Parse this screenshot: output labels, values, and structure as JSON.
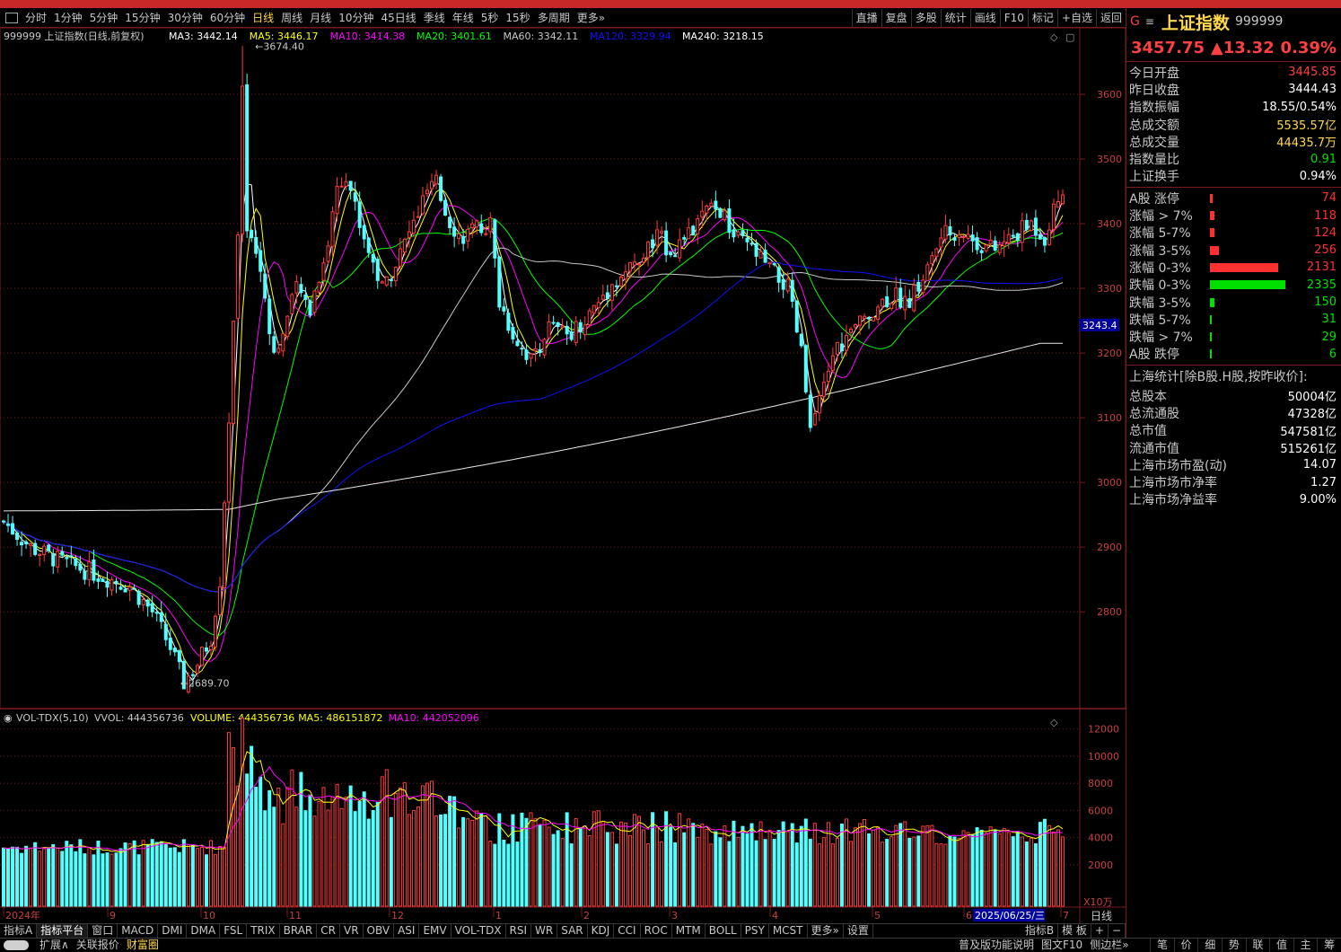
{
  "toolbar": {
    "periods": [
      "分时",
      "1分钟",
      "5分钟",
      "15分钟",
      "30分钟",
      "60分钟",
      "日线",
      "周线",
      "月线",
      "10分钟",
      "45日线",
      "季线",
      "年线",
      "5秒",
      "15秒",
      "多周期",
      "更多»"
    ],
    "selected": "日线",
    "right": [
      "直播",
      "复盘",
      "多股",
      "统计",
      "画线",
      "F10",
      "标记",
      "+自选",
      "返回"
    ]
  },
  "chart": {
    "legend_title": "999999 上证指数(日线,前复权)",
    "ma": [
      {
        "label": "MA3: 3442.14",
        "color": "#ffffff"
      },
      {
        "label": "MA5: 3446.17",
        "color": "#ffff00"
      },
      {
        "label": "MA10: 3414.38",
        "color": "#ff00ff"
      },
      {
        "label": "MA20: 3401.61",
        "color": "#00ff00"
      },
      {
        "label": "MA60: 3342.11",
        "color": "#c8c8c8"
      },
      {
        "label": "MA120: 3329.94",
        "color": "#1010ff"
      },
      {
        "label": "MA240: 3218.15",
        "color": "#ffffff"
      }
    ],
    "high_label": "3674.40",
    "low_label": "2689.70",
    "current_price_tag": "3243.4",
    "price_ticks": [
      "3600",
      "3500",
      "3400",
      "3300",
      "3200",
      "3100",
      "3000",
      "2900",
      "2800"
    ],
    "vol_legend": {
      "title": "VOL-TDX(5,10)",
      "items": [
        {
          "label": "VVOL: 444356736",
          "color": "#c8c8c8"
        },
        {
          "label": "VOLUME: 444356736",
          "color": "#ffff00"
        },
        {
          "label": "MA5: 486151872",
          "color": "#ffff00"
        },
        {
          "label": "MA10: 442052096",
          "color": "#ff00ff"
        }
      ]
    },
    "vol_ticks": [
      "12000",
      "10000",
      "8000",
      "6000",
      "4000",
      "2000"
    ],
    "vol_unit": "X10万",
    "date_labels": [
      "2024年",
      "9",
      "10",
      "11",
      "12",
      "1",
      "2",
      "3",
      "4",
      "5",
      "6",
      "7"
    ],
    "date_cursor": "2025/06/25/三",
    "axis_period": "日线"
  },
  "quote": {
    "g": "G",
    "menu": "≡",
    "name": "上证指数",
    "code": "999999",
    "price": "3457.75",
    "change": "▲13.32",
    "pct": "0.39%",
    "rows": [
      {
        "label": "今日开盘",
        "value": "3445.85",
        "color": "#ff4040"
      },
      {
        "label": "昨日收盘",
        "value": "3444.43",
        "color": "#ffffff"
      },
      {
        "label": "指数振幅",
        "value": "18.55/0.54%",
        "color": "#ffffff"
      },
      {
        "label": "总成交额",
        "value": "5535.57亿",
        "color": "#ffd84a"
      },
      {
        "label": "总成交量",
        "value": "44435.7万",
        "color": "#ffd84a"
      },
      {
        "label": "指数量比",
        "value": "0.91",
        "color": "#00e000"
      },
      {
        "label": "上证换手",
        "value": "0.94%",
        "color": "#ffffff"
      }
    ],
    "bars": [
      {
        "label": "A股 涨停",
        "value": "74",
        "color": "#ff3030",
        "pct": 0.035
      },
      {
        "label": "涨幅 > 7%",
        "value": "118",
        "color": "#ff3030",
        "pct": 0.056
      },
      {
        "label": "涨幅 5-7%",
        "value": "124",
        "color": "#ff3030",
        "pct": 0.059
      },
      {
        "label": "涨幅 3-5%",
        "value": "256",
        "color": "#ff3030",
        "pct": 0.12
      },
      {
        "label": "涨幅 0-3%",
        "value": "2131",
        "color": "#ff3030",
        "pct": 0.91
      },
      {
        "label": "跌幅 0-3%",
        "value": "2335",
        "color": "#00e000",
        "pct": 1.0
      },
      {
        "label": "跌幅 3-5%",
        "value": "150",
        "color": "#00e000",
        "pct": 0.064
      },
      {
        "label": "跌幅 5-7%",
        "value": "31",
        "color": "#00e000",
        "pct": 0.013
      },
      {
        "label": "跌幅 > 7%",
        "value": "29",
        "color": "#00e000",
        "pct": 0.012
      },
      {
        "label": "A股 跌停",
        "value": "6",
        "color": "#00e000",
        "pct": 0.003
      }
    ],
    "stats_title": "上海统计[除B股.H股,按昨收价]:",
    "stats": [
      {
        "label": "总股本",
        "value": "50004亿"
      },
      {
        "label": "总流通股",
        "value": "47328亿"
      },
      {
        "label": "总市值",
        "value": "547581亿"
      },
      {
        "label": "流通市值",
        "value": "515261亿"
      },
      {
        "label": "上海市场市盈(动)",
        "value": "14.07"
      },
      {
        "label": "上海市场市净率",
        "value": "1.27"
      },
      {
        "label": "上海市场净益率",
        "value": "9.00%"
      }
    ]
  },
  "bottom": {
    "tabs": [
      "指标A",
      "指标平台",
      "窗口",
      "MACD",
      "DMI",
      "DMA",
      "FSL",
      "TRIX",
      "BRAR",
      "CR",
      "VR",
      "OBV",
      "ASI",
      "EMV",
      "VOL-TDX",
      "RSI",
      "WR",
      "SAR",
      "KDJ",
      "CCI",
      "ROC",
      "MTM",
      "BOLL",
      "PSY",
      "MCST",
      "更多»",
      "设置"
    ],
    "selected": "指标平台",
    "right_tabs": [
      "指标B",
      "模 板",
      "+",
      "−"
    ],
    "row2": [
      "扩展∧",
      "关联报价",
      "财富圈"
    ],
    "row2_right": [
      "普及版功能说明",
      "图文F10",
      "侧边栏»"
    ],
    "quote_tabs": [
      "笔",
      "价",
      "细",
      "势",
      "联",
      "值",
      "主",
      "筹"
    ]
  }
}
